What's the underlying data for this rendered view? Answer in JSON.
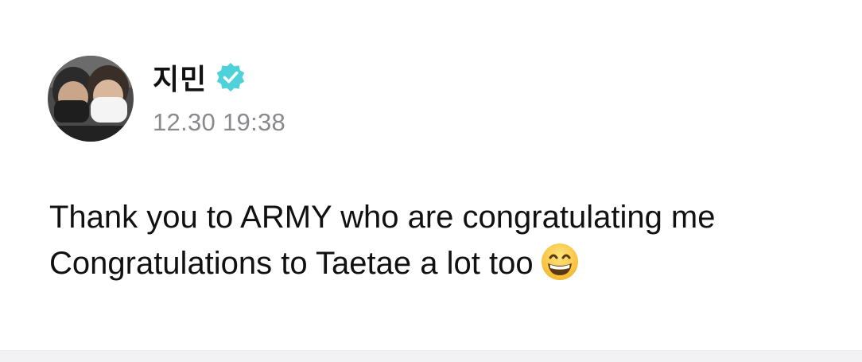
{
  "post": {
    "author": {
      "name": "지민",
      "verified": true,
      "verified_color": "#4fd1d9",
      "avatar": "profile-photo"
    },
    "timestamp": "12.30 19:38",
    "body": {
      "line1": "Thank you to ARMY who are congratulating me",
      "line2": "Congratulations to Taetae a lot too",
      "emoji": "grinning-face-with-smiling-eyes"
    }
  }
}
